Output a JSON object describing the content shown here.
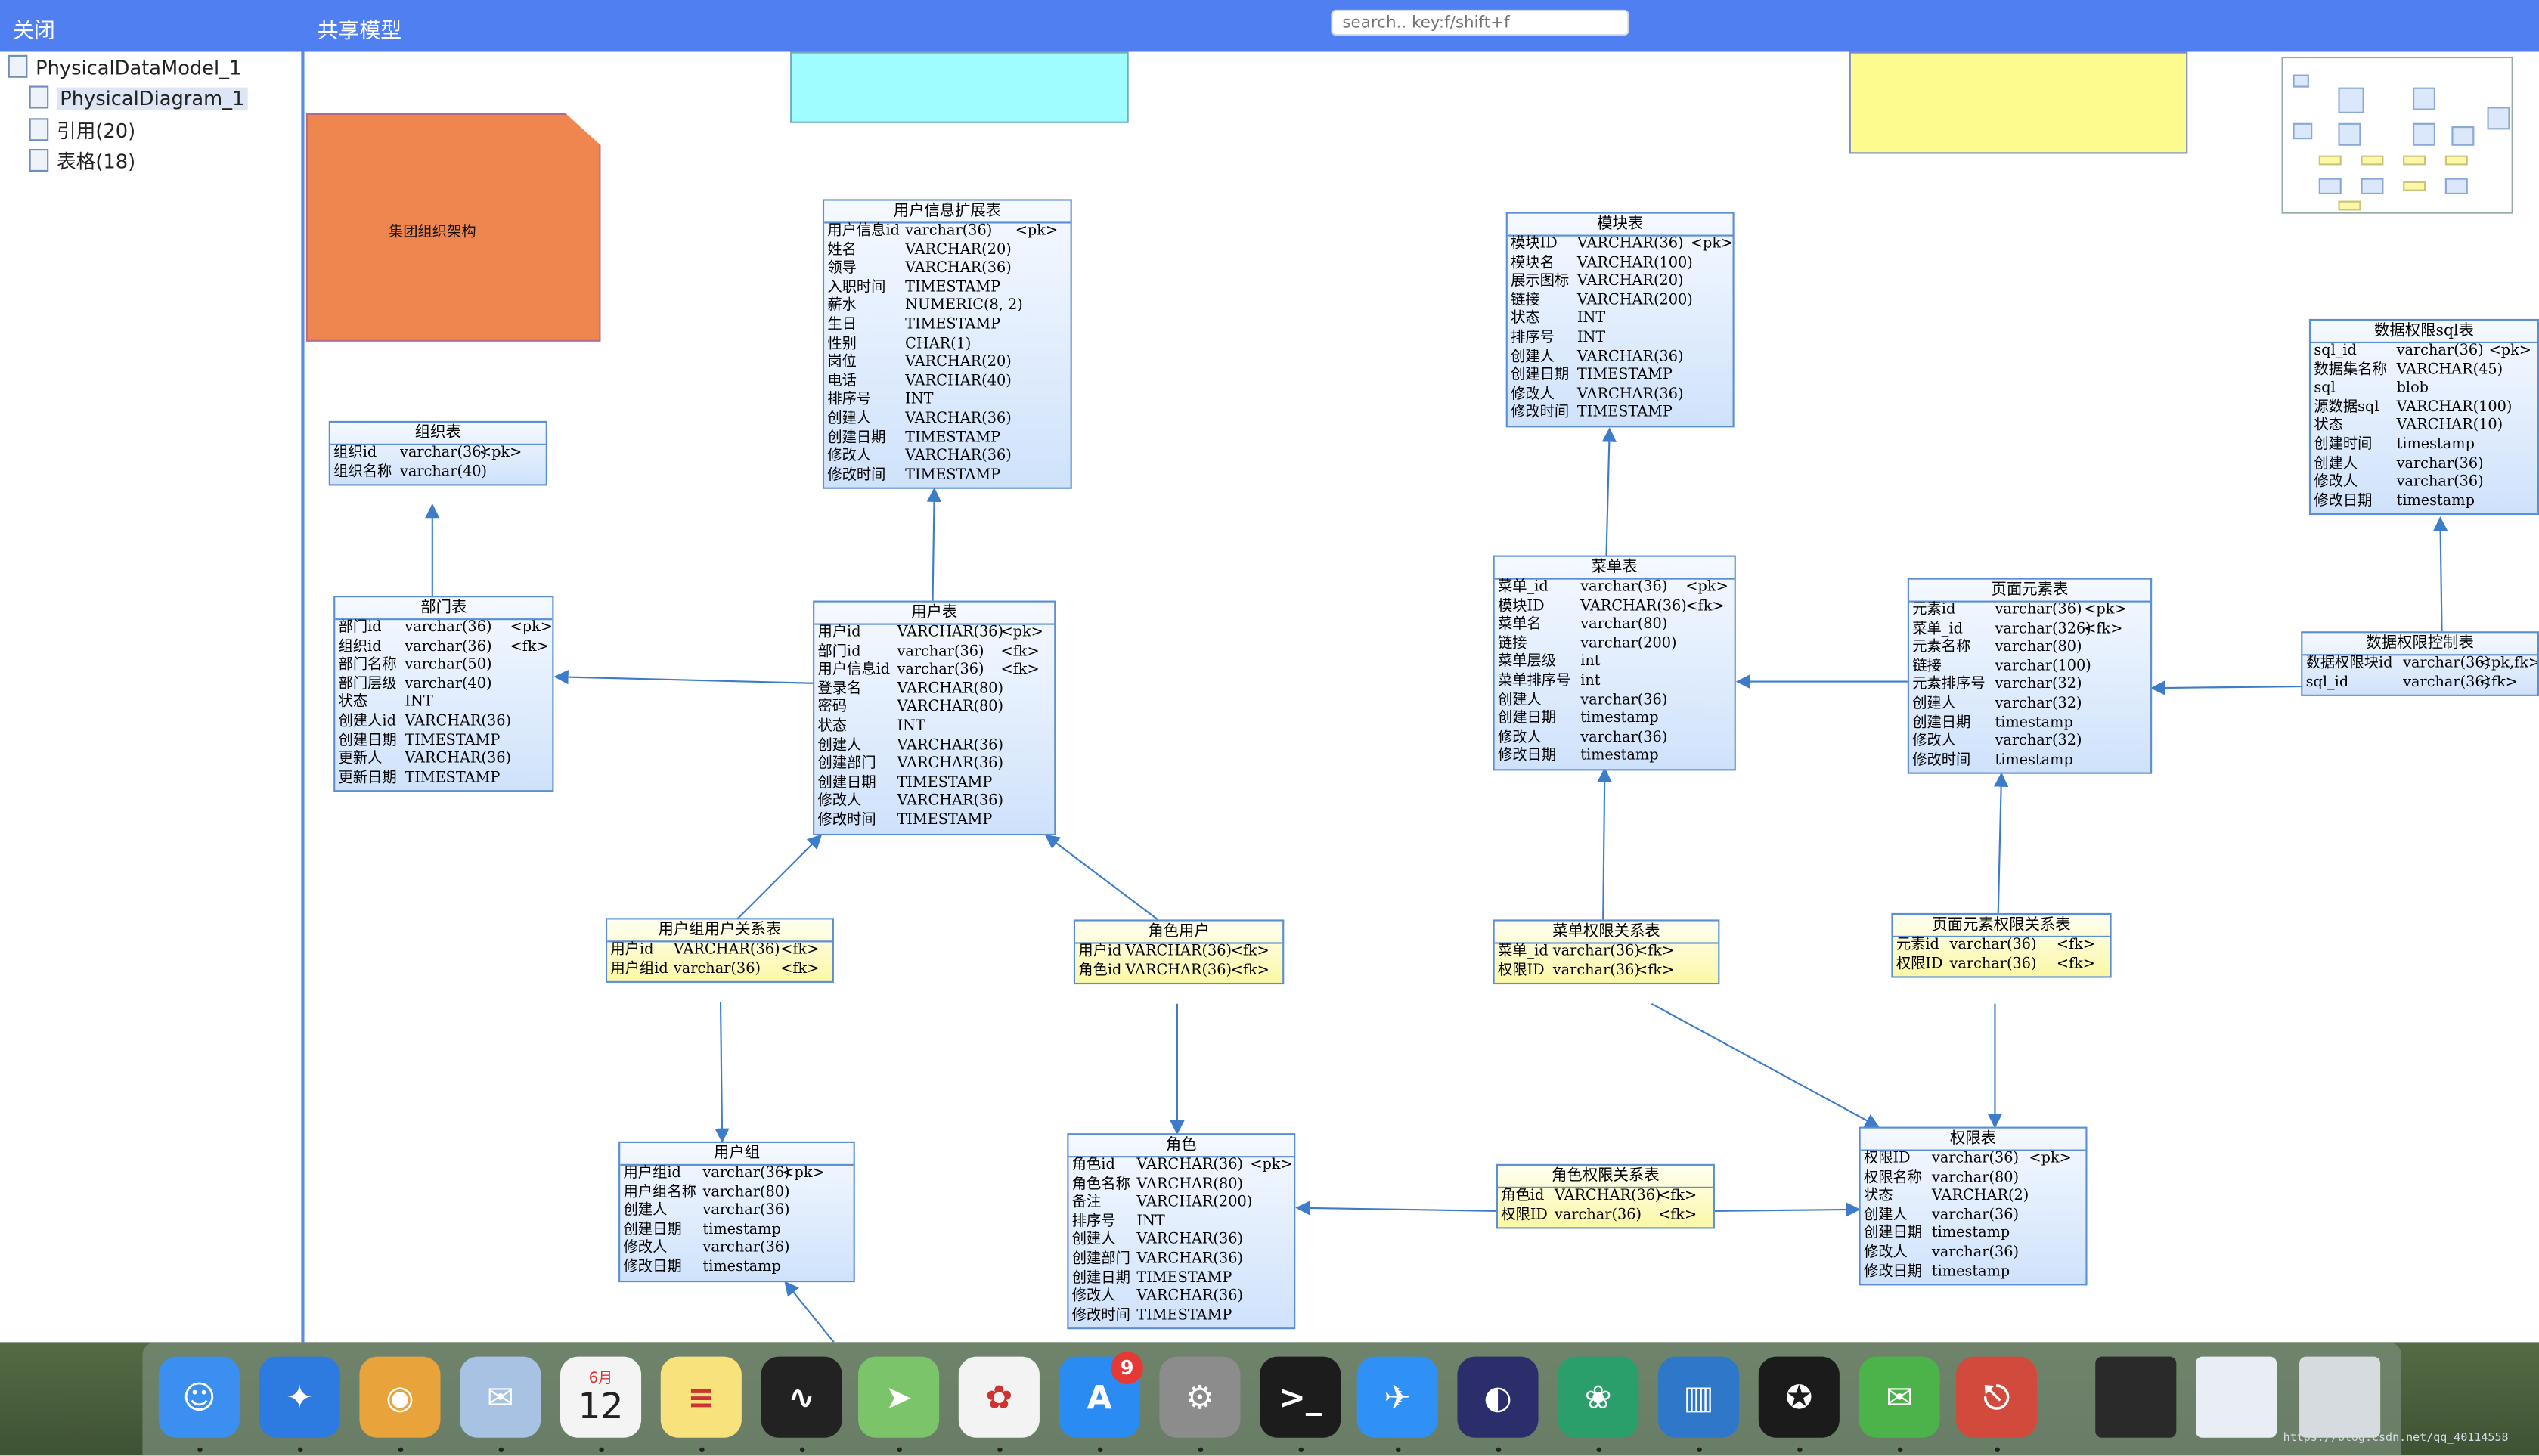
{
  "toolbar": {
    "close_label": "关闭",
    "title": "共享模型",
    "search_placeholder": "search.. key:f/shift+f"
  },
  "tree": {
    "root": "PhysicalDataModel_1",
    "items": [
      {
        "label": "PhysicalDiagram_1",
        "selected": true
      },
      {
        "label": "引用(20)",
        "selected": false
      },
      {
        "label": "表格(18)",
        "selected": false
      }
    ]
  },
  "notes": {
    "org_arch": "集团组织架构"
  },
  "tables": {
    "user_ext": {
      "title": "用户信息扩展表",
      "rows": [
        [
          "用户信息id",
          "varchar(36)",
          "<pk>"
        ],
        [
          "姓名",
          "VARCHAR(20)",
          ""
        ],
        [
          "领导",
          "VARCHAR(36)",
          ""
        ],
        [
          "入职时间",
          "TIMESTAMP",
          ""
        ],
        [
          "薪水",
          "NUMERIC(8, 2)",
          ""
        ],
        [
          "生日",
          "TIMESTAMP",
          ""
        ],
        [
          "性别",
          "CHAR(1)",
          ""
        ],
        [
          "岗位",
          "VARCHAR(20)",
          ""
        ],
        [
          "电话",
          "VARCHAR(40)",
          ""
        ],
        [
          "排序号",
          "INT",
          ""
        ],
        [
          "创建人",
          "VARCHAR(36)",
          ""
        ],
        [
          "创建日期",
          "TIMESTAMP",
          ""
        ],
        [
          "修改人",
          "VARCHAR(36)",
          ""
        ],
        [
          "修改时间",
          "TIMESTAMP",
          ""
        ]
      ]
    },
    "org": {
      "title": "组织表",
      "rows": [
        [
          "组织id",
          "varchar(36)",
          "<pk>"
        ],
        [
          "组织名称",
          "varchar(40)",
          ""
        ]
      ]
    },
    "dept": {
      "title": "部门表",
      "rows": [
        [
          "部门id",
          "varchar(36)",
          "<pk>"
        ],
        [
          "组织id",
          "varchar(36)",
          "<fk>"
        ],
        [
          "部门名称",
          "varchar(50)",
          ""
        ],
        [
          "部门层级",
          "varchar(40)",
          ""
        ],
        [
          "状态",
          "INT",
          ""
        ],
        [
          "创建人id",
          "VARCHAR(36)",
          ""
        ],
        [
          "创建日期",
          "TIMESTAMP",
          ""
        ],
        [
          "更新人",
          "VARCHAR(36)",
          ""
        ],
        [
          "更新日期",
          "TIMESTAMP",
          ""
        ]
      ]
    },
    "user": {
      "title": "用户表",
      "rows": [
        [
          "用户id",
          "VARCHAR(36)",
          "<pk>"
        ],
        [
          "部门id",
          "varchar(36)",
          "<fk>"
        ],
        [
          "用户信息id",
          "varchar(36)",
          "<fk>"
        ],
        [
          "登录名",
          "VARCHAR(80)",
          ""
        ],
        [
          "密码",
          "VARCHAR(80)",
          ""
        ],
        [
          "状态",
          "INT",
          ""
        ],
        [
          "创建人",
          "VARCHAR(36)",
          ""
        ],
        [
          "创建部门",
          "VARCHAR(36)",
          ""
        ],
        [
          "创建日期",
          "TIMESTAMP",
          ""
        ],
        [
          "修改人",
          "VARCHAR(36)",
          ""
        ],
        [
          "修改时间",
          "TIMESTAMP",
          ""
        ]
      ]
    },
    "module": {
      "title": "模块表",
      "rows": [
        [
          "模块ID",
          "VARCHAR(36)",
          "<pk>"
        ],
        [
          "模块名",
          "VARCHAR(100)",
          ""
        ],
        [
          "展示图标",
          "VARCHAR(20)",
          ""
        ],
        [
          "链接",
          "VARCHAR(200)",
          ""
        ],
        [
          "状态",
          "INT",
          ""
        ],
        [
          "排序号",
          "INT",
          ""
        ],
        [
          "创建人",
          "VARCHAR(36)",
          ""
        ],
        [
          "创建日期",
          "TIMESTAMP",
          ""
        ],
        [
          "修改人",
          "VARCHAR(36)",
          ""
        ],
        [
          "修改时间",
          "TIMESTAMP",
          ""
        ]
      ]
    },
    "menu": {
      "title": "菜单表",
      "rows": [
        [
          "菜单_id",
          "varchar(36)",
          "<pk>"
        ],
        [
          "模块ID",
          "VARCHAR(36)",
          "<fk>"
        ],
        [
          "菜单名",
          "varchar(80)",
          ""
        ],
        [
          "链接",
          "varchar(200)",
          ""
        ],
        [
          "菜单层级",
          "int",
          ""
        ],
        [
          "菜单排序号",
          "int",
          ""
        ],
        [
          "创建人",
          "varchar(36)",
          ""
        ],
        [
          "创建日期",
          "timestamp",
          ""
        ],
        [
          "修改人",
          "varchar(36)",
          ""
        ],
        [
          "修改日期",
          "timestamp",
          ""
        ]
      ]
    },
    "page_elem": {
      "title": "页面元素表",
      "rows": [
        [
          "元素id",
          "varchar(36)",
          "<pk>"
        ],
        [
          "菜单_id",
          "varchar(326)",
          "<fk>"
        ],
        [
          "元素名称",
          "varchar(80)",
          ""
        ],
        [
          "链接",
          "varchar(100)",
          ""
        ],
        [
          "元素排序号",
          "varchar(32)",
          ""
        ],
        [
          "创建人",
          "varchar(32)",
          ""
        ],
        [
          "创建日期",
          "timestamp",
          ""
        ],
        [
          "修改人",
          "varchar(32)",
          ""
        ],
        [
          "修改时间",
          "timestamp",
          ""
        ]
      ]
    },
    "data_perm_sql": {
      "title": "数据权限sql表",
      "rows": [
        [
          "sql_id",
          "varchar(36)",
          "<pk>"
        ],
        [
          "数据集名称",
          "VARCHAR(45)",
          ""
        ],
        [
          "sql",
          "blob",
          ""
        ],
        [
          "源数据sql",
          "VARCHAR(100)",
          ""
        ],
        [
          "状态",
          "VARCHAR(10)",
          ""
        ],
        [
          "创建时间",
          "timestamp",
          ""
        ],
        [
          "创建人",
          "varchar(36)",
          ""
        ],
        [
          "修改人",
          "varchar(36)",
          ""
        ],
        [
          "修改日期",
          "timestamp",
          ""
        ]
      ]
    },
    "data_perm_ctrl": {
      "title": "数据权限控制表",
      "rows": [
        [
          "数据权限块id",
          "varchar(36)",
          "<pk,fk>"
        ],
        [
          "sql_id",
          "varchar(36)",
          "<fk>"
        ]
      ]
    },
    "group_user": {
      "title": "用户组用户关系表",
      "rows": [
        [
          "用户id",
          "VARCHAR(36)",
          "<fk>"
        ],
        [
          "用户组id",
          "varchar(36)",
          "<fk>"
        ]
      ]
    },
    "role_user": {
      "title": "角色用户",
      "rows": [
        [
          "用户id",
          "VARCHAR(36)",
          "<fk>"
        ],
        [
          "角色id",
          "VARCHAR(36)",
          "<fk>"
        ]
      ]
    },
    "menu_perm": {
      "title": "菜单权限关系表",
      "rows": [
        [
          "菜单_id",
          "varchar(36)",
          "<fk>"
        ],
        [
          "权限ID",
          "varchar(36)",
          "<fk>"
        ]
      ]
    },
    "elem_perm": {
      "title": "页面元素权限关系表",
      "rows": [
        [
          "元素id",
          "varchar(36)",
          "<fk>"
        ],
        [
          "权限ID",
          "varchar(36)",
          "<fk>"
        ]
      ]
    },
    "group": {
      "title": "用户组",
      "rows": [
        [
          "用户组id",
          "varchar(36)",
          "<pk>"
        ],
        [
          "用户组名称",
          "varchar(80)",
          ""
        ],
        [
          "创建人",
          "varchar(36)",
          ""
        ],
        [
          "创建日期",
          "timestamp",
          ""
        ],
        [
          "修改人",
          "varchar(36)",
          ""
        ],
        [
          "修改日期",
          "timestamp",
          ""
        ]
      ]
    },
    "role": {
      "title": "角色",
      "rows": [
        [
          "角色id",
          "VARCHAR(36)",
          "<pk>"
        ],
        [
          "角色名称",
          "VARCHAR(80)",
          ""
        ],
        [
          "备注",
          "VARCHAR(200)",
          ""
        ],
        [
          "排序号",
          "INT",
          ""
        ],
        [
          "创建人",
          "VARCHAR(36)",
          ""
        ],
        [
          "创建部门",
          "VARCHAR(36)",
          ""
        ],
        [
          "创建日期",
          "TIMESTAMP",
          ""
        ],
        [
          "修改人",
          "VARCHAR(36)",
          ""
        ],
        [
          "修改时间",
          "TIMESTAMP",
          ""
        ]
      ]
    },
    "role_perm": {
      "title": "角色权限关系表",
      "rows": [
        [
          "角色id",
          "VARCHAR(36)",
          "<fk>"
        ],
        [
          "权限ID",
          "varchar(36)",
          "<fk>"
        ]
      ]
    },
    "perm": {
      "title": "权限表",
      "rows": [
        [
          "权限ID",
          "varchar(36)",
          "<pk>"
        ],
        [
          "权限名称",
          "varchar(80)",
          ""
        ],
        [
          "状态",
          "VARCHAR(2)",
          ""
        ],
        [
          "创建人",
          "varchar(36)",
          ""
        ],
        [
          "创建日期",
          "timestamp",
          ""
        ],
        [
          "修改人",
          "varchar(36)",
          ""
        ],
        [
          "修改日期",
          "timestamp",
          ""
        ]
      ]
    }
  },
  "dock": {
    "apps": [
      {
        "name": "finder-icon",
        "glyph": "☺",
        "color": "#3b8ff0"
      },
      {
        "name": "safari-icon",
        "glyph": "✦",
        "color": "#2d7ae0"
      },
      {
        "name": "chrome-icon",
        "glyph": "◉",
        "color": "#e8a33a"
      },
      {
        "name": "mail-icon",
        "glyph": "✉",
        "color": "#a7c2e3"
      },
      {
        "name": "calendar-icon",
        "glyph": "12",
        "color": "#f4f4f4"
      },
      {
        "name": "notes-icon",
        "glyph": "≡",
        "color": "#f8e27b"
      },
      {
        "name": "activity-monitor-icon",
        "glyph": "∿",
        "color": "#222222"
      },
      {
        "name": "maps-icon",
        "glyph": "➤",
        "color": "#7cc46a"
      },
      {
        "name": "photos-icon",
        "glyph": "✿",
        "color": "#f3f3f3"
      },
      {
        "name": "app-store-icon",
        "glyph": "A",
        "color": "#2a8bf2"
      },
      {
        "name": "system-preferences-icon",
        "glyph": "⚙",
        "color": "#8c8c8c"
      },
      {
        "name": "terminal-icon",
        "glyph": ">_",
        "color": "#1c1c1c"
      },
      {
        "name": "dingtalk-icon",
        "glyph": "✈",
        "color": "#2f90f5"
      },
      {
        "name": "eclipse-icon",
        "glyph": "◐",
        "color": "#2c2e6b"
      },
      {
        "name": "navicat-icon",
        "glyph": "❀",
        "color": "#2b9f6b"
      },
      {
        "name": "trello-icon",
        "glyph": "▥",
        "color": "#2f77c9"
      },
      {
        "name": "qq-icon",
        "glyph": "✪",
        "color": "#1b1b1b"
      },
      {
        "name": "wechat-icon",
        "glyph": "✉",
        "color": "#4cb34a"
      },
      {
        "name": "screen-share-icon",
        "glyph": "⎋",
        "color": "#d24a3c"
      }
    ],
    "calendar": {
      "month": "6月",
      "day": "12"
    },
    "appstore_badge": "9"
  },
  "watermark": "https://blog.csdn.net/qq_40114558"
}
